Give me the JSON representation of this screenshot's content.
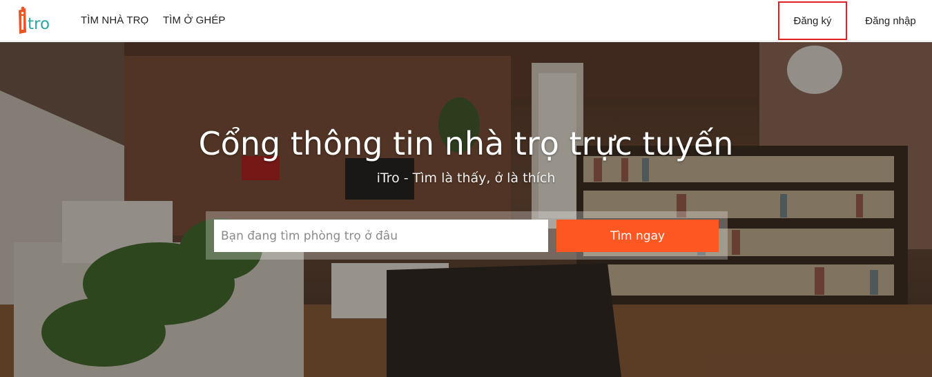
{
  "header": {
    "logo_text": "iTro",
    "nav": [
      {
        "label": "TÌM NHÀ TRỌ"
      },
      {
        "label": "TÌM Ở GHÉP"
      }
    ],
    "register_label": "Đăng ký",
    "login_label": "Đăng nhập"
  },
  "hero": {
    "title": "Cổng thông tin nhà trọ trực tuyến",
    "subtitle": "iTro - Tìm là thấy, ở là thích",
    "search": {
      "placeholder": "Bạn đang tìm phòng trọ ở đâu",
      "value": "",
      "button_label": "Tìm ngay"
    }
  },
  "colors": {
    "brand_orange": "#ff5722",
    "logo_orange": "#e8562a",
    "logo_teal": "#2aa6a0",
    "register_border": "#e02020"
  }
}
